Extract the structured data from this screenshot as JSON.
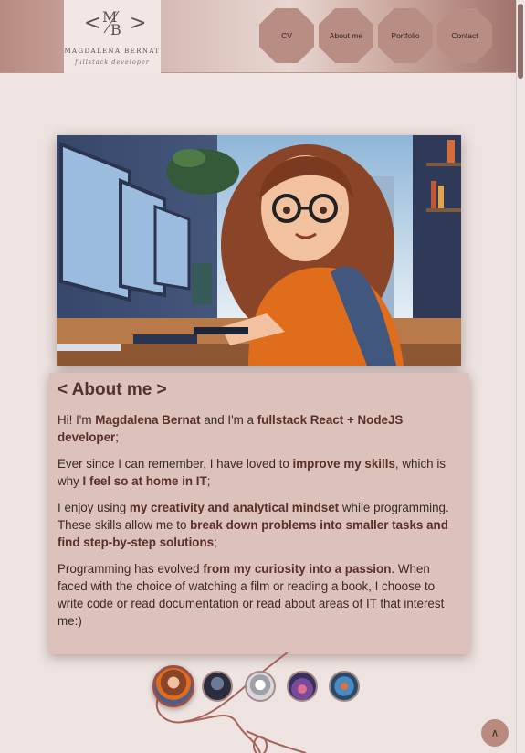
{
  "header": {
    "logo_name": "MAGDALENA BERNAT",
    "logo_subtitle": "fullstack developer",
    "nav": [
      "CV",
      "About me",
      "Portfolio",
      "Contact"
    ]
  },
  "about": {
    "title": "< About me >",
    "p1": [
      {
        "t": "Hi! I'm ",
        "b": false
      },
      {
        "t": "Magdalena Bernat",
        "b": true
      },
      {
        "t": " and I'm a ",
        "b": false
      },
      {
        "t": "fullstack React + NodeJS developer",
        "b": true
      },
      {
        "t": ";",
        "b": false
      }
    ],
    "p2": [
      {
        "t": "Ever since I can remember, I have loved to ",
        "b": false
      },
      {
        "t": "improve my skills",
        "b": true
      },
      {
        "t": ", which is why ",
        "b": false
      },
      {
        "t": "I feel so at home in IT",
        "b": true
      },
      {
        "t": ";",
        "b": false
      }
    ],
    "p3": [
      {
        "t": "I enjoy using ",
        "b": false
      },
      {
        "t": "my creativity and analytical mindset",
        "b": true
      },
      {
        "t": " while programming. These skills allow me to ",
        "b": false
      },
      {
        "t": "break down problems into smaller tasks and find step-by-step solutions",
        "b": true
      },
      {
        "t": ";",
        "b": false
      }
    ],
    "p4": [
      {
        "t": "Programming has evolved ",
        "b": false
      },
      {
        "t": "from my curiosity into a passion",
        "b": true
      },
      {
        "t": ". When faced with the choice of watching a film or reading a book, I choose to write code or read documentation or read about areas of IT that interest me:)",
        "b": false
      }
    ]
  },
  "carousel": {
    "count": 5,
    "active_index": 0
  },
  "colors": {
    "accent": "#b98a80",
    "card": "#dcc2bb",
    "background": "#ede3e1"
  },
  "icons": {
    "scroll_top": "chevron-up-icon"
  }
}
